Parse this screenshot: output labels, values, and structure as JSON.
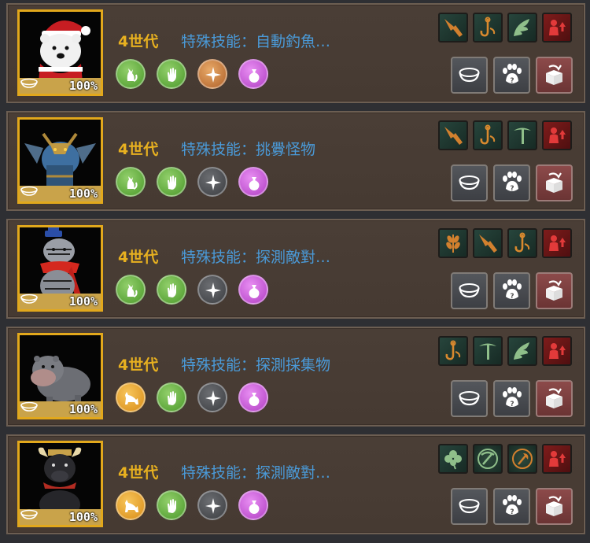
{
  "pets": [
    {
      "generation": "4世代",
      "skill": "特殊技能：自動釣魚…",
      "growth": "100%",
      "portrait": "polar-bear-santa",
      "traits": [
        {
          "icon": "cat",
          "color": "green"
        },
        {
          "icon": "hand",
          "color": "green"
        },
        {
          "icon": "compass",
          "color": "orange"
        },
        {
          "icon": "pouch",
          "color": "purple"
        }
      ],
      "skills": [
        {
          "icon": "rifle",
          "color": "dark"
        },
        {
          "icon": "fishhook",
          "color": "dark"
        },
        {
          "icon": "wing",
          "color": "dark"
        },
        {
          "icon": "person-up",
          "color": "red"
        }
      ]
    },
    {
      "generation": "4世代",
      "skill": "特殊技能：挑釁怪物",
      "growth": "100%",
      "portrait": "blue-dragon",
      "traits": [
        {
          "icon": "cat",
          "color": "green"
        },
        {
          "icon": "hand",
          "color": "green"
        },
        {
          "icon": "compass",
          "color": "gray"
        },
        {
          "icon": "pouch",
          "color": "purple"
        }
      ],
      "skills": [
        {
          "icon": "rifle",
          "color": "dark"
        },
        {
          "icon": "fishhook",
          "color": "dark"
        },
        {
          "icon": "pickaxe",
          "color": "dark"
        },
        {
          "icon": "person-up",
          "color": "red"
        }
      ]
    },
    {
      "generation": "4世代",
      "skill": "特殊技能：探測敵對…",
      "growth": "100%",
      "portrait": "tiger-scarf",
      "traits": [
        {
          "icon": "cat",
          "color": "green"
        },
        {
          "icon": "hand",
          "color": "green"
        },
        {
          "icon": "compass",
          "color": "gray"
        },
        {
          "icon": "pouch",
          "color": "purple"
        }
      ],
      "skills": [
        {
          "icon": "wheat",
          "color": "dark"
        },
        {
          "icon": "rifle",
          "color": "dark"
        },
        {
          "icon": "fishhook",
          "color": "dark"
        },
        {
          "icon": "person-up",
          "color": "red"
        }
      ]
    },
    {
      "generation": "4世代",
      "skill": "特殊技能：探測採集物",
      "growth": "100%",
      "portrait": "baby-hippo",
      "traits": [
        {
          "icon": "cat",
          "color": "yellow"
        },
        {
          "icon": "hand",
          "color": "green"
        },
        {
          "icon": "compass",
          "color": "gray"
        },
        {
          "icon": "pouch",
          "color": "purple"
        }
      ],
      "skills": [
        {
          "icon": "fishhook",
          "color": "dark"
        },
        {
          "icon": "pickaxe",
          "color": "dark"
        },
        {
          "icon": "wing",
          "color": "dark"
        },
        {
          "icon": "person-up",
          "color": "red"
        }
      ]
    },
    {
      "generation": "4世代",
      "skill": "特殊技能：探測敵對…",
      "growth": "100%",
      "portrait": "black-ox",
      "traits": [
        {
          "icon": "cat",
          "color": "yellow"
        },
        {
          "icon": "hand",
          "color": "green"
        },
        {
          "icon": "compass",
          "color": "gray"
        },
        {
          "icon": "pouch",
          "color": "purple"
        }
      ],
      "skills": [
        {
          "icon": "clover",
          "color": "dark"
        },
        {
          "icon": "pickaxe-round",
          "color": "dark"
        },
        {
          "icon": "axe-round",
          "color": "dark"
        },
        {
          "icon": "person-up",
          "color": "red"
        }
      ]
    }
  ],
  "actions": [
    {
      "icon": "feed-bowl-icon"
    },
    {
      "icon": "paw-icon"
    },
    {
      "icon": "release-box-icon"
    }
  ],
  "colors": {
    "gold": "#e7b020",
    "skillBlue": "#4a9ad8",
    "panel": "#463a32"
  }
}
